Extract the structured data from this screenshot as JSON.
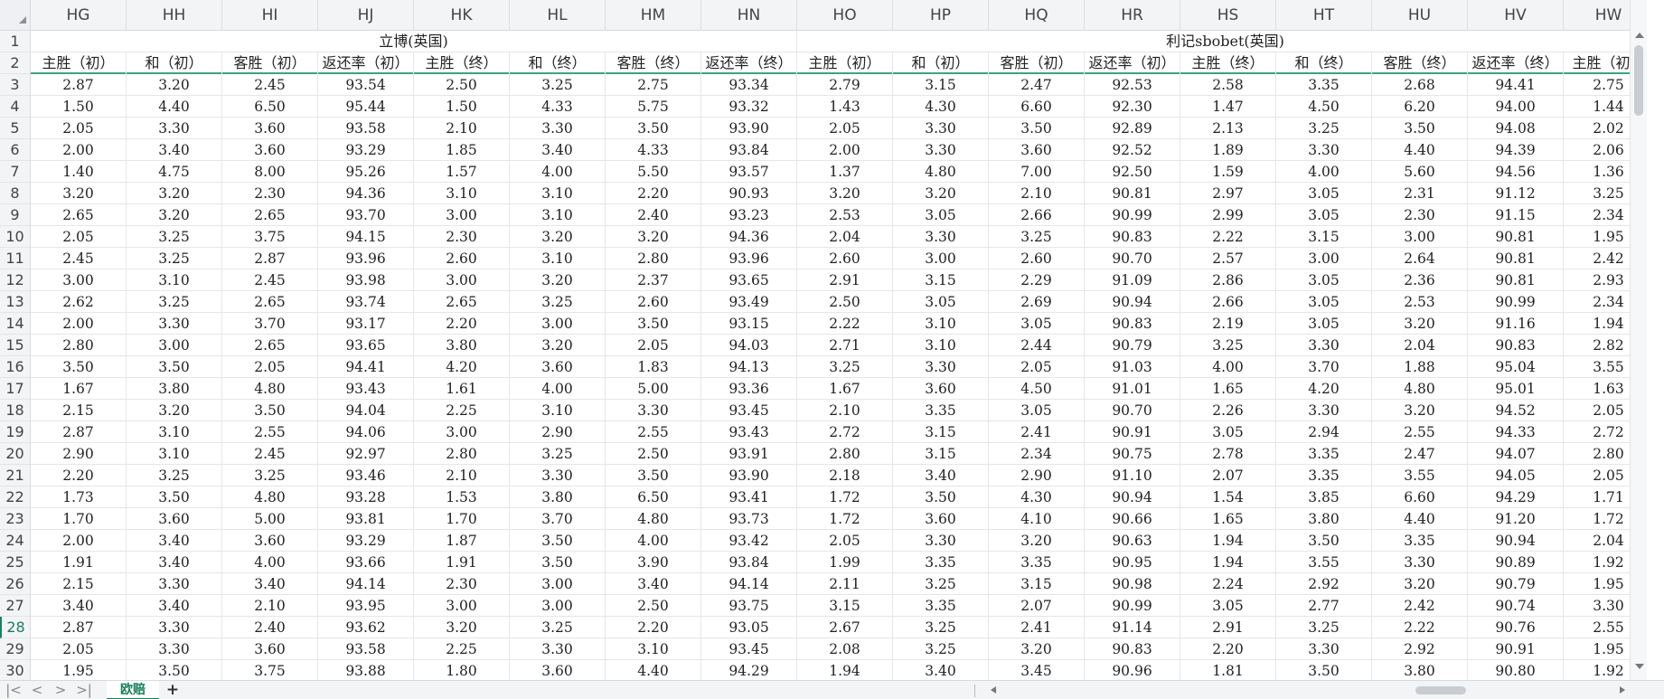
{
  "columns": [
    "HG",
    "HH",
    "HI",
    "HJ",
    "HK",
    "HL",
    "HM",
    "HN",
    "HO",
    "HP",
    "HQ",
    "HR",
    "HS",
    "HT",
    "HU",
    "HV",
    "HW"
  ],
  "row_numbers": [
    "1",
    "2",
    "3",
    "4",
    "5",
    "6",
    "7",
    "8",
    "9",
    "10",
    "11",
    "12",
    "13",
    "14",
    "15",
    "16",
    "17",
    "18",
    "19",
    "20",
    "21",
    "22",
    "23",
    "24",
    "25",
    "26",
    "27",
    "28",
    "29",
    "30"
  ],
  "active_row": "28",
  "groups": [
    {
      "title": "立博(英国)"
    },
    {
      "title": "利记sbobet(英国)"
    }
  ],
  "labels": [
    "主胜（初）",
    "和（初）",
    "客胜（初）",
    "返还率（初）",
    "主胜（终）",
    "和（终）",
    "客胜（终）",
    "返还率（终）",
    "主胜（初）",
    "和（初）",
    "客胜（初）",
    "返还率（初）",
    "主胜（终）",
    "和（终）",
    "客胜（终）",
    "返还率（终）",
    "主胜（初）"
  ],
  "rows": [
    [
      "2.87",
      "3.20",
      "2.45",
      "93.54",
      "2.50",
      "3.25",
      "2.75",
      "93.34",
      "2.79",
      "3.15",
      "2.47",
      "92.53",
      "2.58",
      "3.35",
      "2.68",
      "94.41",
      "2.75"
    ],
    [
      "1.50",
      "4.40",
      "6.50",
      "95.44",
      "1.50",
      "4.33",
      "5.75",
      "93.32",
      "1.43",
      "4.30",
      "6.60",
      "92.30",
      "1.47",
      "4.50",
      "6.20",
      "94.00",
      "1.44"
    ],
    [
      "2.05",
      "3.30",
      "3.60",
      "93.58",
      "2.10",
      "3.30",
      "3.50",
      "93.90",
      "2.05",
      "3.30",
      "3.50",
      "92.89",
      "2.13",
      "3.25",
      "3.50",
      "94.08",
      "2.02"
    ],
    [
      "2.00",
      "3.40",
      "3.60",
      "93.29",
      "1.85",
      "3.40",
      "4.33",
      "93.84",
      "2.00",
      "3.30",
      "3.60",
      "92.52",
      "1.89",
      "3.30",
      "4.40",
      "94.39",
      "2.06"
    ],
    [
      "1.40",
      "4.75",
      "8.00",
      "95.26",
      "1.57",
      "4.00",
      "5.50",
      "93.57",
      "1.37",
      "4.80",
      "7.00",
      "92.50",
      "1.59",
      "4.00",
      "5.60",
      "94.56",
      "1.36"
    ],
    [
      "3.20",
      "3.20",
      "2.30",
      "94.36",
      "3.10",
      "3.10",
      "2.20",
      "90.93",
      "3.20",
      "3.20",
      "2.10",
      "90.81",
      "2.97",
      "3.05",
      "2.31",
      "91.12",
      "3.25"
    ],
    [
      "2.65",
      "3.20",
      "2.65",
      "93.70",
      "3.00",
      "3.10",
      "2.40",
      "93.23",
      "2.53",
      "3.05",
      "2.66",
      "90.99",
      "2.99",
      "3.05",
      "2.30",
      "91.15",
      "2.34"
    ],
    [
      "2.05",
      "3.25",
      "3.75",
      "94.15",
      "2.30",
      "3.20",
      "3.20",
      "94.36",
      "2.04",
      "3.30",
      "3.25",
      "90.83",
      "2.22",
      "3.15",
      "3.00",
      "90.81",
      "1.95"
    ],
    [
      "2.45",
      "3.25",
      "2.87",
      "93.96",
      "2.60",
      "3.10",
      "2.80",
      "93.96",
      "2.60",
      "3.00",
      "2.60",
      "90.70",
      "2.57",
      "3.00",
      "2.64",
      "90.81",
      "2.42"
    ],
    [
      "3.00",
      "3.10",
      "2.45",
      "93.98",
      "3.00",
      "3.20",
      "2.37",
      "93.65",
      "2.91",
      "3.15",
      "2.29",
      "91.09",
      "2.86",
      "3.05",
      "2.36",
      "90.81",
      "2.93"
    ],
    [
      "2.62",
      "3.25",
      "2.65",
      "93.74",
      "2.65",
      "3.25",
      "2.60",
      "93.49",
      "2.50",
      "3.05",
      "2.69",
      "90.94",
      "2.66",
      "3.05",
      "2.53",
      "90.99",
      "2.34"
    ],
    [
      "2.00",
      "3.30",
      "3.70",
      "93.17",
      "2.20",
      "3.00",
      "3.50",
      "93.15",
      "2.22",
      "3.10",
      "3.05",
      "90.83",
      "2.19",
      "3.05",
      "3.20",
      "91.16",
      "1.94"
    ],
    [
      "2.80",
      "3.00",
      "2.65",
      "93.65",
      "3.80",
      "3.20",
      "2.05",
      "94.03",
      "2.71",
      "3.10",
      "2.44",
      "90.79",
      "3.25",
      "3.30",
      "2.04",
      "90.83",
      "2.82"
    ],
    [
      "3.50",
      "3.50",
      "2.05",
      "94.41",
      "4.20",
      "3.60",
      "1.83",
      "94.13",
      "3.25",
      "3.30",
      "2.05",
      "91.03",
      "4.00",
      "3.70",
      "1.88",
      "95.04",
      "3.55"
    ],
    [
      "1.67",
      "3.80",
      "4.80",
      "93.43",
      "1.61",
      "4.00",
      "5.00",
      "93.36",
      "1.67",
      "3.60",
      "4.50",
      "91.01",
      "1.65",
      "4.20",
      "4.80",
      "95.01",
      "1.63"
    ],
    [
      "2.15",
      "3.20",
      "3.50",
      "94.04",
      "2.25",
      "3.10",
      "3.30",
      "93.45",
      "2.10",
      "3.35",
      "3.05",
      "90.70",
      "2.26",
      "3.30",
      "3.20",
      "94.52",
      "2.05"
    ],
    [
      "2.87",
      "3.10",
      "2.55",
      "94.06",
      "3.00",
      "2.90",
      "2.55",
      "93.43",
      "2.72",
      "3.15",
      "2.41",
      "90.91",
      "3.05",
      "2.94",
      "2.55",
      "94.33",
      "2.72"
    ],
    [
      "2.90",
      "3.10",
      "2.45",
      "92.97",
      "2.80",
      "3.25",
      "2.50",
      "93.91",
      "2.80",
      "3.15",
      "2.34",
      "90.75",
      "2.78",
      "3.35",
      "2.47",
      "94.07",
      "2.80"
    ],
    [
      "2.20",
      "3.25",
      "3.25",
      "93.46",
      "2.10",
      "3.30",
      "3.50",
      "93.90",
      "2.18",
      "3.40",
      "2.90",
      "91.10",
      "2.07",
      "3.35",
      "3.55",
      "94.05",
      "2.05"
    ],
    [
      "1.73",
      "3.50",
      "4.80",
      "93.28",
      "1.53",
      "3.80",
      "6.50",
      "93.41",
      "1.72",
      "3.50",
      "4.30",
      "90.94",
      "1.54",
      "3.85",
      "6.60",
      "94.29",
      "1.71"
    ],
    [
      "1.70",
      "3.60",
      "5.00",
      "93.81",
      "1.70",
      "3.70",
      "4.80",
      "93.73",
      "1.72",
      "3.60",
      "4.10",
      "90.66",
      "1.65",
      "3.80",
      "4.40",
      "91.20",
      "1.72"
    ],
    [
      "2.00",
      "3.40",
      "3.60",
      "93.29",
      "1.87",
      "3.50",
      "4.00",
      "93.42",
      "2.05",
      "3.30",
      "3.20",
      "90.63",
      "1.94",
      "3.50",
      "3.35",
      "90.94",
      "2.04"
    ],
    [
      "1.91",
      "3.40",
      "4.00",
      "93.66",
      "1.91",
      "3.50",
      "3.90",
      "93.84",
      "1.99",
      "3.35",
      "3.35",
      "90.95",
      "1.94",
      "3.55",
      "3.30",
      "90.89",
      "1.92"
    ],
    [
      "2.15",
      "3.30",
      "3.40",
      "94.14",
      "2.30",
      "3.00",
      "3.40",
      "94.14",
      "2.11",
      "3.25",
      "3.15",
      "90.98",
      "2.24",
      "2.92",
      "3.20",
      "90.79",
      "1.95"
    ],
    [
      "3.40",
      "3.40",
      "2.10",
      "93.95",
      "3.00",
      "3.00",
      "2.50",
      "93.75",
      "3.15",
      "3.35",
      "2.07",
      "90.99",
      "3.05",
      "2.77",
      "2.42",
      "90.74",
      "3.30"
    ],
    [
      "2.87",
      "3.30",
      "2.40",
      "93.62",
      "3.20",
      "3.25",
      "2.20",
      "93.05",
      "2.67",
      "3.25",
      "2.41",
      "91.14",
      "2.91",
      "3.25",
      "2.22",
      "90.76",
      "2.55"
    ],
    [
      "2.05",
      "3.30",
      "3.60",
      "93.58",
      "2.25",
      "3.30",
      "3.10",
      "93.45",
      "2.08",
      "3.25",
      "3.20",
      "90.83",
      "2.20",
      "3.30",
      "2.92",
      "90.91",
      "1.95"
    ],
    [
      "1.95",
      "3.50",
      "3.75",
      "93.88",
      "1.80",
      "3.60",
      "4.40",
      "94.29",
      "1.94",
      "3.40",
      "3.45",
      "90.96",
      "1.81",
      "3.50",
      "3.80",
      "90.80",
      "1.92"
    ]
  ],
  "sheet_tab": "欧赔",
  "add_sheet": "+",
  "nav": {
    "first": "|<",
    "prev": "<",
    "next": ">",
    "last": ">|"
  }
}
